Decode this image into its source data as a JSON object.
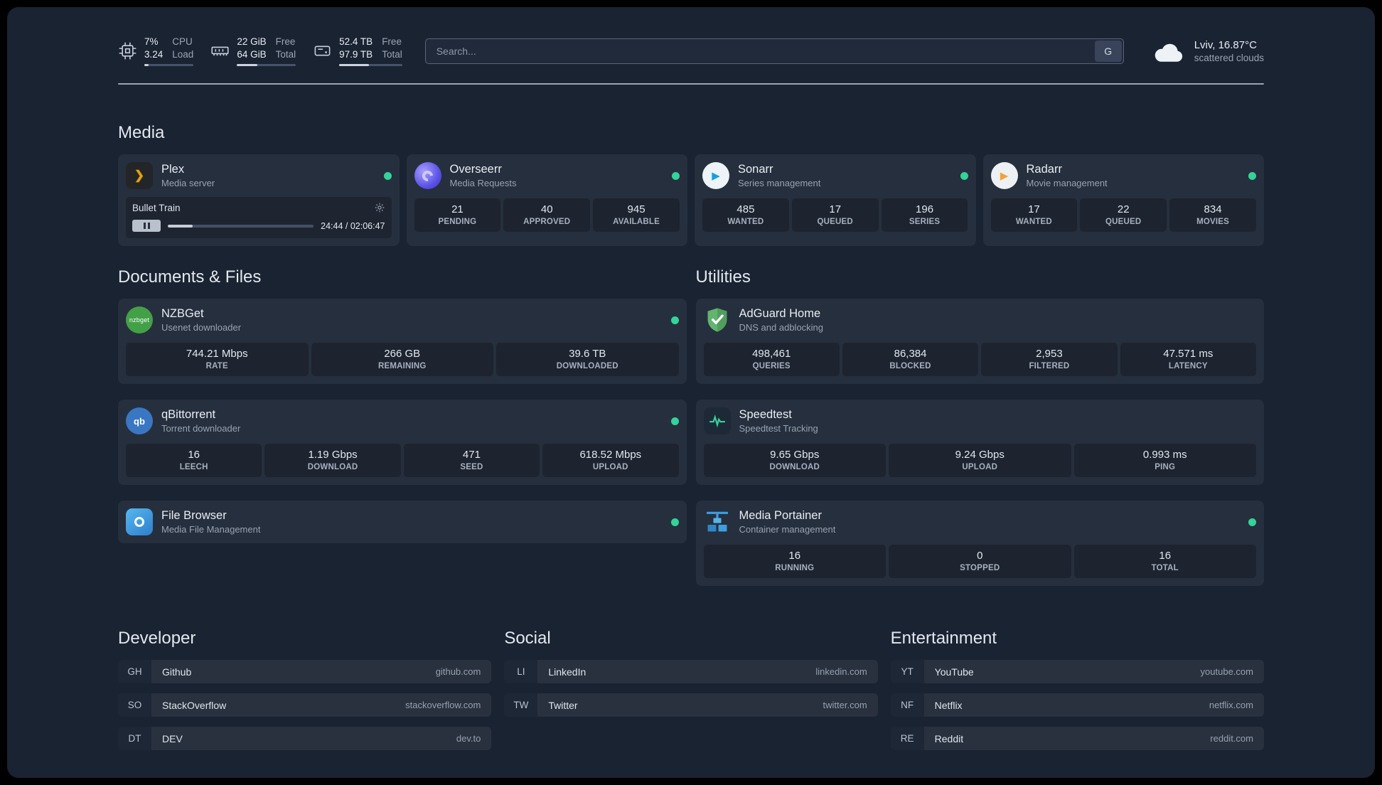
{
  "header": {
    "resources": [
      {
        "values": [
          "7%",
          "3.24"
        ],
        "labels": [
          "CPU",
          "Load"
        ],
        "progress": 8
      },
      {
        "values": [
          "22 GiB",
          "64 GiB"
        ],
        "labels": [
          "Free",
          "Total"
        ],
        "progress": 35
      },
      {
        "values": [
          "52.4 TB",
          "97.9 TB"
        ],
        "labels": [
          "Free",
          "Total"
        ],
        "progress": 47
      }
    ],
    "search": {
      "placeholder": "Search...",
      "provider": "G"
    },
    "weather": {
      "location": "Lviv, 16.87°C",
      "condition": "scattered clouds"
    }
  },
  "media": {
    "title": "Media",
    "cards": [
      {
        "name": "Plex",
        "desc": "Media server",
        "player": {
          "title": "Bullet Train",
          "time": "24:44 / 02:06:47",
          "progress": 17
        }
      },
      {
        "name": "Overseerr",
        "desc": "Media Requests",
        "stats": [
          {
            "value": "21",
            "label": "PENDING"
          },
          {
            "value": "40",
            "label": "APPROVED"
          },
          {
            "value": "945",
            "label": "AVAILABLE"
          }
        ]
      },
      {
        "name": "Sonarr",
        "desc": "Series management",
        "stats": [
          {
            "value": "485",
            "label": "WANTED"
          },
          {
            "value": "17",
            "label": "QUEUED"
          },
          {
            "value": "196",
            "label": "SERIES"
          }
        ]
      },
      {
        "name": "Radarr",
        "desc": "Movie management",
        "stats": [
          {
            "value": "17",
            "label": "WANTED"
          },
          {
            "value": "22",
            "label": "QUEUED"
          },
          {
            "value": "834",
            "label": "MOVIES"
          }
        ]
      }
    ]
  },
  "documents": {
    "title": "Documents & Files",
    "cards": [
      {
        "name": "NZBGet",
        "desc": "Usenet downloader",
        "stats": [
          {
            "value": "744.21 Mbps",
            "label": "RATE"
          },
          {
            "value": "266 GB",
            "label": "REMAINING"
          },
          {
            "value": "39.6 TB",
            "label": "DOWNLOADED"
          }
        ]
      },
      {
        "name": "qBittorrent",
        "desc": "Torrent downloader",
        "stats": [
          {
            "value": "16",
            "label": "LEECH"
          },
          {
            "value": "1.19 Gbps",
            "label": "DOWNLOAD"
          },
          {
            "value": "471",
            "label": "SEED"
          },
          {
            "value": "618.52 Mbps",
            "label": "UPLOAD"
          }
        ]
      },
      {
        "name": "File Browser",
        "desc": "Media File Management",
        "stats": []
      }
    ]
  },
  "utilities": {
    "title": "Utilities",
    "cards": [
      {
        "name": "AdGuard Home",
        "desc": "DNS and adblocking",
        "stats": [
          {
            "value": "498,461",
            "label": "QUERIES"
          },
          {
            "value": "86,384",
            "label": "BLOCKED"
          },
          {
            "value": "2,953",
            "label": "FILTERED"
          },
          {
            "value": "47.571 ms",
            "label": "LATENCY"
          }
        ]
      },
      {
        "name": "Speedtest",
        "desc": "Speedtest Tracking",
        "stats": [
          {
            "value": "9.65 Gbps",
            "label": "DOWNLOAD"
          },
          {
            "value": "9.24 Gbps",
            "label": "UPLOAD"
          },
          {
            "value": "0.993 ms",
            "label": "PING"
          }
        ]
      },
      {
        "name": "Media Portainer",
        "desc": "Container management",
        "stats": [
          {
            "value": "16",
            "label": "RUNNING"
          },
          {
            "value": "0",
            "label": "STOPPED"
          },
          {
            "value": "16",
            "label": "TOTAL"
          }
        ]
      }
    ]
  },
  "bookmarks": {
    "groups": [
      {
        "title": "Developer",
        "items": [
          {
            "abbr": "GH",
            "name": "Github",
            "domain": "github.com"
          },
          {
            "abbr": "SO",
            "name": "StackOverflow",
            "domain": "stackoverflow.com"
          },
          {
            "abbr": "DT",
            "name": "DEV",
            "domain": "dev.to"
          }
        ]
      },
      {
        "title": "Social",
        "items": [
          {
            "abbr": "LI",
            "name": "LinkedIn",
            "domain": "linkedin.com"
          },
          {
            "abbr": "TW",
            "name": "Twitter",
            "domain": "twitter.com"
          }
        ]
      },
      {
        "title": "Entertainment",
        "items": [
          {
            "abbr": "YT",
            "name": "YouTube",
            "domain": "youtube.com"
          },
          {
            "abbr": "NF",
            "name": "Netflix",
            "domain": "netflix.com"
          },
          {
            "abbr": "RE",
            "name": "Reddit",
            "domain": "reddit.com"
          }
        ]
      }
    ]
  },
  "icons": {
    "nzbget_label": "nzbget",
    "qbittorrent_label": "qb",
    "plex_chevron": "❯",
    "play_glyph": "▶"
  },
  "colors": {
    "status_online": "#34d399"
  }
}
